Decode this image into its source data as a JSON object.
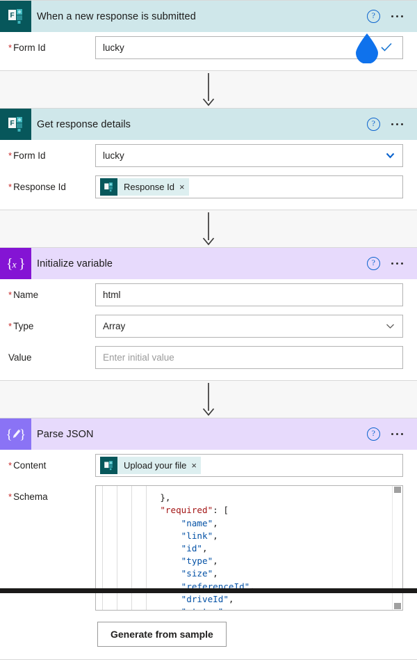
{
  "colors": {
    "forms_icon_bg": "#07575b",
    "forms_header_bg": "#cfe7ea",
    "variable_icon_bg": "#8414d4",
    "parsejson_icon_bg": "#8a73f5",
    "purple_header_bg": "#e7dafc",
    "accent_blue": "#0b63ce",
    "required_red": "#c62828",
    "canvas_bg": "#f7f7f7",
    "chip_bg": "#ddeff0",
    "cursor_droplet": "#0f72ec"
  },
  "cards": [
    {
      "id": "when-a-new-response-is-submitted",
      "title": "When a new response is submitted",
      "icon": "microsoft-forms-icon",
      "help_icon": "help-icon",
      "menu_icon": "more-options-icon",
      "fields": [
        {
          "label": "Form Id",
          "required": true,
          "kind": "text",
          "value": "lucky",
          "placeholder": ""
        }
      ]
    },
    {
      "id": "get-response-details",
      "title": "Get response details",
      "icon": "microsoft-forms-icon",
      "help_icon": "help-icon",
      "menu_icon": "more-options-icon",
      "fields": [
        {
          "label": "Form Id",
          "required": true,
          "kind": "dropdown",
          "value": "lucky",
          "placeholder": ""
        },
        {
          "label": "Response Id",
          "required": true,
          "kind": "token",
          "token_label": "Response Id",
          "token_icon": "microsoft-forms-icon",
          "token_remove": "×"
        }
      ]
    },
    {
      "id": "initialize-variable",
      "title": "Initialize variable",
      "icon": "variable-braces-x-icon",
      "help_icon": "help-icon",
      "menu_icon": "more-options-icon",
      "fields": [
        {
          "label": "Name",
          "required": true,
          "kind": "text",
          "value": "html",
          "placeholder": ""
        },
        {
          "label": "Type",
          "required": true,
          "kind": "dropdown",
          "value": "Array",
          "placeholder": ""
        },
        {
          "label": "Value",
          "required": false,
          "kind": "text",
          "value": "",
          "placeholder": "Enter initial value"
        }
      ]
    },
    {
      "id": "parse-json",
      "title": "Parse JSON",
      "icon": "parse-json-braces-pencil-icon",
      "help_icon": "help-icon",
      "menu_icon": "more-options-icon",
      "fields": [
        {
          "label": "Content",
          "required": true,
          "kind": "token",
          "token_label": "Upload your file",
          "token_icon": "microsoft-forms-icon",
          "token_remove": "×"
        },
        {
          "label": "Schema",
          "required": true,
          "kind": "code"
        }
      ],
      "generate_button": "Generate from sample"
    }
  ],
  "schema_editor": {
    "lines": [
      {
        "indent": 0,
        "text": "",
        "clipped": true
      },
      {
        "indent": 3,
        "text": "},",
        "type": "punct"
      },
      {
        "indent": 3,
        "text": "\"required\": [",
        "type": "key"
      },
      {
        "indent": 4,
        "text": "\"name\",",
        "type": "str"
      },
      {
        "indent": 4,
        "text": "\"link\",",
        "type": "str"
      },
      {
        "indent": 4,
        "text": "\"id\",",
        "type": "str"
      },
      {
        "indent": 4,
        "text": "\"type\",",
        "type": "str"
      },
      {
        "indent": 4,
        "text": "\"size\",",
        "type": "str"
      },
      {
        "indent": 4,
        "text": "\"referenceId\",",
        "type": "str"
      },
      {
        "indent": 4,
        "text": "\"driveId\",",
        "type": "str"
      },
      {
        "indent": 4,
        "text": "\"status\",",
        "type": "str"
      }
    ],
    "scrollbar": "vertical-scrollbar"
  }
}
